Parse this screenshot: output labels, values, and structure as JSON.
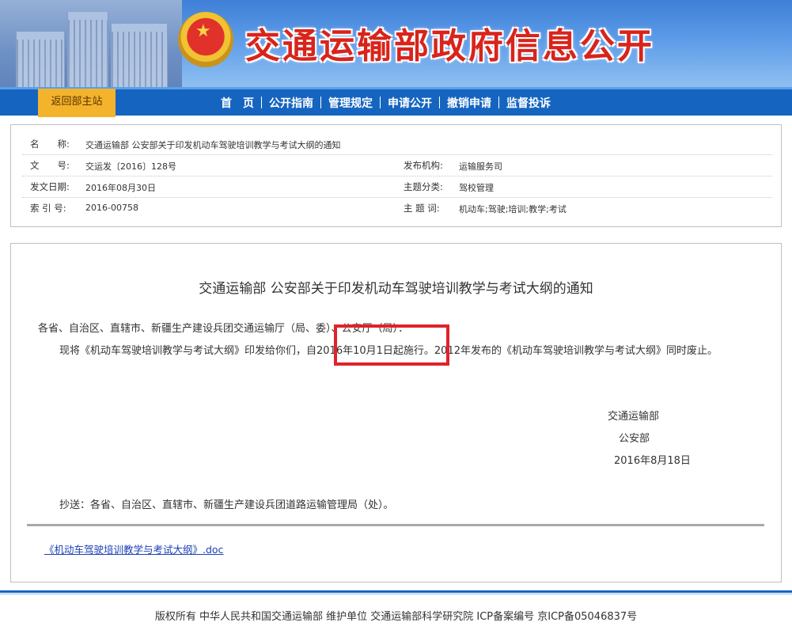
{
  "header": {
    "site_title": "交通运输部政府信息公开",
    "back_button": "返回部主站",
    "nav": [
      "首　页",
      "公开指南",
      "管理规定",
      "申请公开",
      "撤销申请",
      "监督投诉"
    ]
  },
  "meta": {
    "name_label": "名　　称:",
    "name_value": "交通运输部 公安部关于印发机动车驾驶培训教学与考试大纲的通知",
    "docno_label": "文　　号:",
    "docno_value": "交运发〔2016〕128号",
    "org_label": "发布机构:",
    "org_value": "运输服务司",
    "date_label": "发文日期:",
    "date_value": "2016年08月30日",
    "topic_label": "主题分类:",
    "topic_value": "驾校管理",
    "index_label": "索 引 号:",
    "index_value": "2016-00758",
    "keywords_label": "主 题 词:",
    "keywords_value": "机动车;驾驶;培训;教学;考试"
  },
  "doc": {
    "title": "交通运输部 公安部关于印发机动车驾驶培训教学与考试大纲的通知",
    "salutation": "各省、自治区、直辖市、新疆生产建设兵团交通运输厅（局、委）、公安厅（局）：",
    "body": "现将《机动车驾驶培训教学与考试大纲》印发给你们，自2016年10月1日起施行。2012年发布的《机动车驾驶培训教学与考试大纲》同时废止。",
    "signer1": "交通运输部",
    "signer2": "公安部",
    "sign_date": "2016年8月18日",
    "cc": "抄送：各省、自治区、直辖市、新疆生产建设兵团道路运输管理局（处）。",
    "attachment": "《机动车驾驶培训教学与考试大纲》.doc"
  },
  "footer": {
    "text": "版权所有 中华人民共和国交通运输部 维护单位 交通运输部科学研究院 ICP备案编号 京ICP备05046837号"
  },
  "colors": {
    "nav_bg": "#1565c0",
    "back_btn": "#f3b42c",
    "title_red": "#d8241b",
    "highlight_box": "#e0222a"
  },
  "icons": [
    "national-emblem"
  ]
}
